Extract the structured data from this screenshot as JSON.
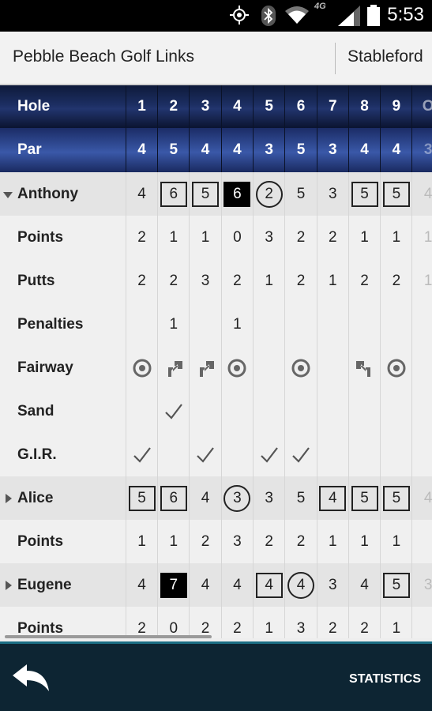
{
  "status_bar": {
    "time": "5:53",
    "network": "4G"
  },
  "header": {
    "course_name": "Pebble Beach Golf Links",
    "scoring_mode": "Stableford"
  },
  "holes": {
    "label": "Hole",
    "numbers": [
      "1",
      "2",
      "3",
      "4",
      "5",
      "6",
      "7",
      "8",
      "9",
      "O"
    ]
  },
  "par": {
    "label": "Par",
    "values": [
      "4",
      "5",
      "4",
      "4",
      "3",
      "5",
      "3",
      "4",
      "4",
      "3"
    ]
  },
  "players": [
    {
      "name": "Anthony",
      "expanded": true,
      "scores": [
        {
          "v": "4",
          "s": "plain"
        },
        {
          "v": "6",
          "s": "box"
        },
        {
          "v": "5",
          "s": "box"
        },
        {
          "v": "6",
          "s": "filled"
        },
        {
          "v": "2",
          "s": "circle"
        },
        {
          "v": "5",
          "s": "plain"
        },
        {
          "v": "3",
          "s": "plain"
        },
        {
          "v": "5",
          "s": "box"
        },
        {
          "v": "5",
          "s": "box"
        },
        {
          "v": "4",
          "s": "faded"
        }
      ],
      "stats": [
        {
          "label": "Points",
          "values": [
            "2",
            "1",
            "1",
            "0",
            "3",
            "2",
            "2",
            "1",
            "1",
            "1"
          ]
        },
        {
          "label": "Putts",
          "values": [
            "2",
            "2",
            "3",
            "2",
            "1",
            "2",
            "1",
            "2",
            "2",
            "1"
          ]
        },
        {
          "label": "Penalties",
          "values": [
            "",
            "1",
            "",
            "1",
            "",
            "",
            "",
            "",
            "",
            ""
          ]
        },
        {
          "label": "Fairway",
          "icons": [
            "target-icon",
            "arrow-right-icon",
            "arrow-right-icon",
            "target-icon",
            "",
            "target-icon",
            "",
            "arrow-left-icon",
            "target-icon",
            ""
          ]
        },
        {
          "label": "Sand",
          "icons": [
            "",
            "check-icon",
            "",
            "",
            "",
            "",
            "",
            "",
            "",
            ""
          ]
        },
        {
          "label": "G.I.R.",
          "icons": [
            "check-icon",
            "",
            "check-icon",
            "",
            "check-icon",
            "check-icon",
            "",
            "",
            "",
            ""
          ]
        }
      ]
    },
    {
      "name": "Alice",
      "expanded": false,
      "scores": [
        {
          "v": "5",
          "s": "box"
        },
        {
          "v": "6",
          "s": "box"
        },
        {
          "v": "4",
          "s": "plain"
        },
        {
          "v": "3",
          "s": "circle"
        },
        {
          "v": "3",
          "s": "plain"
        },
        {
          "v": "5",
          "s": "plain"
        },
        {
          "v": "4",
          "s": "box"
        },
        {
          "v": "5",
          "s": "box"
        },
        {
          "v": "5",
          "s": "box"
        },
        {
          "v": "4",
          "s": "faded"
        }
      ],
      "stats": [
        {
          "label": "Points",
          "values": [
            "1",
            "1",
            "2",
            "3",
            "2",
            "2",
            "1",
            "1",
            "1",
            ""
          ]
        }
      ]
    },
    {
      "name": "Eugene",
      "expanded": false,
      "scores": [
        {
          "v": "4",
          "s": "plain"
        },
        {
          "v": "7",
          "s": "filled"
        },
        {
          "v": "4",
          "s": "plain"
        },
        {
          "v": "4",
          "s": "plain"
        },
        {
          "v": "4",
          "s": "box"
        },
        {
          "v": "4",
          "s": "circle"
        },
        {
          "v": "3",
          "s": "plain"
        },
        {
          "v": "4",
          "s": "plain"
        },
        {
          "v": "5",
          "s": "box"
        },
        {
          "v": "3",
          "s": "faded"
        }
      ],
      "stats": [
        {
          "label": "Points",
          "values": [
            "2",
            "0",
            "2",
            "2",
            "1",
            "3",
            "2",
            "2",
            "1",
            ""
          ]
        }
      ]
    }
  ],
  "bottom_bar": {
    "statistics_label": "STATISTICS"
  },
  "colors": {
    "header_navy": "#1c2e62",
    "par_blue": "#34509c",
    "bottom_bar": "#0d2533",
    "accent": "#1b6e85"
  }
}
